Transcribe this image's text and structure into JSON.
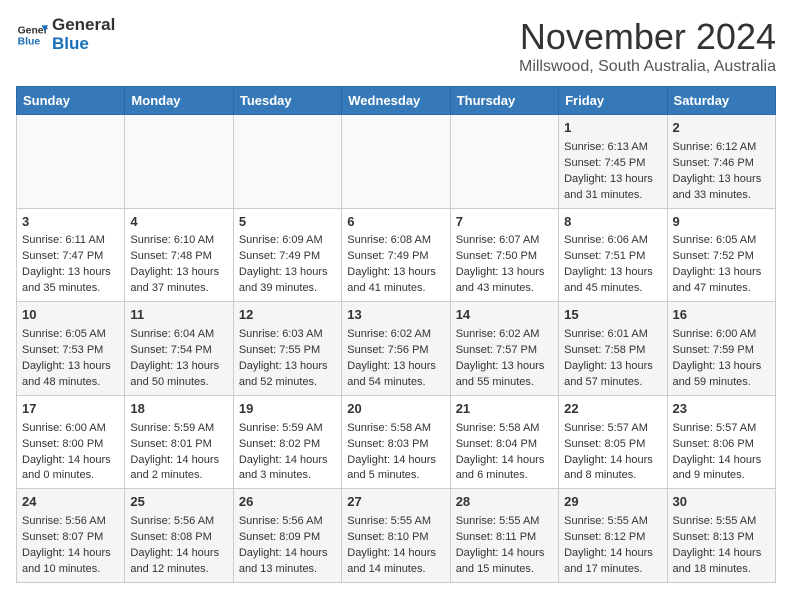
{
  "header": {
    "logo_line1": "General",
    "logo_line2": "Blue",
    "month": "November 2024",
    "location": "Millswood, South Australia, Australia"
  },
  "days_of_week": [
    "Sunday",
    "Monday",
    "Tuesday",
    "Wednesday",
    "Thursday",
    "Friday",
    "Saturday"
  ],
  "weeks": [
    [
      {
        "day": "",
        "info": ""
      },
      {
        "day": "",
        "info": ""
      },
      {
        "day": "",
        "info": ""
      },
      {
        "day": "",
        "info": ""
      },
      {
        "day": "",
        "info": ""
      },
      {
        "day": "1",
        "info": "Sunrise: 6:13 AM\nSunset: 7:45 PM\nDaylight: 13 hours and 31 minutes."
      },
      {
        "day": "2",
        "info": "Sunrise: 6:12 AM\nSunset: 7:46 PM\nDaylight: 13 hours and 33 minutes."
      }
    ],
    [
      {
        "day": "3",
        "info": "Sunrise: 6:11 AM\nSunset: 7:47 PM\nDaylight: 13 hours and 35 minutes."
      },
      {
        "day": "4",
        "info": "Sunrise: 6:10 AM\nSunset: 7:48 PM\nDaylight: 13 hours and 37 minutes."
      },
      {
        "day": "5",
        "info": "Sunrise: 6:09 AM\nSunset: 7:49 PM\nDaylight: 13 hours and 39 minutes."
      },
      {
        "day": "6",
        "info": "Sunrise: 6:08 AM\nSunset: 7:49 PM\nDaylight: 13 hours and 41 minutes."
      },
      {
        "day": "7",
        "info": "Sunrise: 6:07 AM\nSunset: 7:50 PM\nDaylight: 13 hours and 43 minutes."
      },
      {
        "day": "8",
        "info": "Sunrise: 6:06 AM\nSunset: 7:51 PM\nDaylight: 13 hours and 45 minutes."
      },
      {
        "day": "9",
        "info": "Sunrise: 6:05 AM\nSunset: 7:52 PM\nDaylight: 13 hours and 47 minutes."
      }
    ],
    [
      {
        "day": "10",
        "info": "Sunrise: 6:05 AM\nSunset: 7:53 PM\nDaylight: 13 hours and 48 minutes."
      },
      {
        "day": "11",
        "info": "Sunrise: 6:04 AM\nSunset: 7:54 PM\nDaylight: 13 hours and 50 minutes."
      },
      {
        "day": "12",
        "info": "Sunrise: 6:03 AM\nSunset: 7:55 PM\nDaylight: 13 hours and 52 minutes."
      },
      {
        "day": "13",
        "info": "Sunrise: 6:02 AM\nSunset: 7:56 PM\nDaylight: 13 hours and 54 minutes."
      },
      {
        "day": "14",
        "info": "Sunrise: 6:02 AM\nSunset: 7:57 PM\nDaylight: 13 hours and 55 minutes."
      },
      {
        "day": "15",
        "info": "Sunrise: 6:01 AM\nSunset: 7:58 PM\nDaylight: 13 hours and 57 minutes."
      },
      {
        "day": "16",
        "info": "Sunrise: 6:00 AM\nSunset: 7:59 PM\nDaylight: 13 hours and 59 minutes."
      }
    ],
    [
      {
        "day": "17",
        "info": "Sunrise: 6:00 AM\nSunset: 8:00 PM\nDaylight: 14 hours and 0 minutes."
      },
      {
        "day": "18",
        "info": "Sunrise: 5:59 AM\nSunset: 8:01 PM\nDaylight: 14 hours and 2 minutes."
      },
      {
        "day": "19",
        "info": "Sunrise: 5:59 AM\nSunset: 8:02 PM\nDaylight: 14 hours and 3 minutes."
      },
      {
        "day": "20",
        "info": "Sunrise: 5:58 AM\nSunset: 8:03 PM\nDaylight: 14 hours and 5 minutes."
      },
      {
        "day": "21",
        "info": "Sunrise: 5:58 AM\nSunset: 8:04 PM\nDaylight: 14 hours and 6 minutes."
      },
      {
        "day": "22",
        "info": "Sunrise: 5:57 AM\nSunset: 8:05 PM\nDaylight: 14 hours and 8 minutes."
      },
      {
        "day": "23",
        "info": "Sunrise: 5:57 AM\nSunset: 8:06 PM\nDaylight: 14 hours and 9 minutes."
      }
    ],
    [
      {
        "day": "24",
        "info": "Sunrise: 5:56 AM\nSunset: 8:07 PM\nDaylight: 14 hours and 10 minutes."
      },
      {
        "day": "25",
        "info": "Sunrise: 5:56 AM\nSunset: 8:08 PM\nDaylight: 14 hours and 12 minutes."
      },
      {
        "day": "26",
        "info": "Sunrise: 5:56 AM\nSunset: 8:09 PM\nDaylight: 14 hours and 13 minutes."
      },
      {
        "day": "27",
        "info": "Sunrise: 5:55 AM\nSunset: 8:10 PM\nDaylight: 14 hours and 14 minutes."
      },
      {
        "day": "28",
        "info": "Sunrise: 5:55 AM\nSunset: 8:11 PM\nDaylight: 14 hours and 15 minutes."
      },
      {
        "day": "29",
        "info": "Sunrise: 5:55 AM\nSunset: 8:12 PM\nDaylight: 14 hours and 17 minutes."
      },
      {
        "day": "30",
        "info": "Sunrise: 5:55 AM\nSunset: 8:13 PM\nDaylight: 14 hours and 18 minutes."
      }
    ]
  ]
}
